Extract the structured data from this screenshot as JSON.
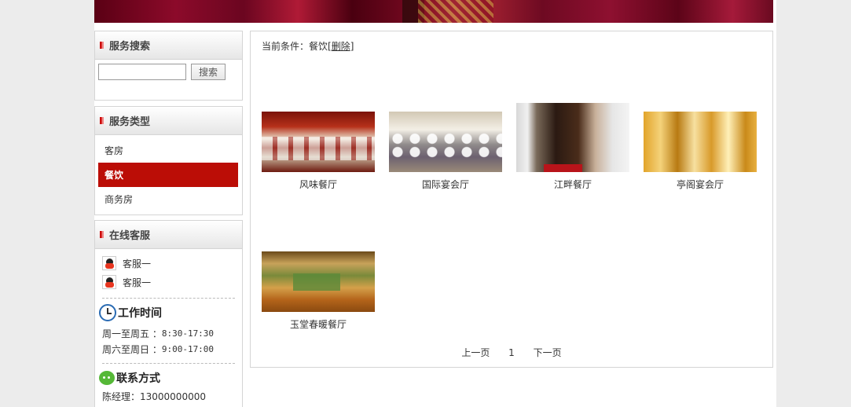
{
  "search": {
    "title": "服务搜索",
    "button": "搜索",
    "value": ""
  },
  "types": {
    "title": "服务类型",
    "items": [
      "客房",
      "餐饮",
      "商务房"
    ],
    "active": "餐饮"
  },
  "service": {
    "title": "在线客服",
    "agents": [
      "客服一",
      "客服一"
    ],
    "work_title": "工作时间",
    "work": [
      {
        "label": "周一至周五 ：",
        "time": "8:30-17:30"
      },
      {
        "label": "周六至周日 ：",
        "time": "9:00-17:00"
      }
    ],
    "contact_title": "联系方式",
    "contact_line": "陈经理：13000000000"
  },
  "main": {
    "condition_prefix": "当前条件：餐饮[",
    "condition_delete": "删除",
    "condition_suffix": "]",
    "items": [
      "风味餐厅",
      "国际宴会厅",
      "江畔餐厅",
      "亭阁宴会厅",
      "玉堂春暖餐厅"
    ],
    "pager": {
      "prev": "上一页",
      "page": "1",
      "next": "下一页"
    }
  }
}
